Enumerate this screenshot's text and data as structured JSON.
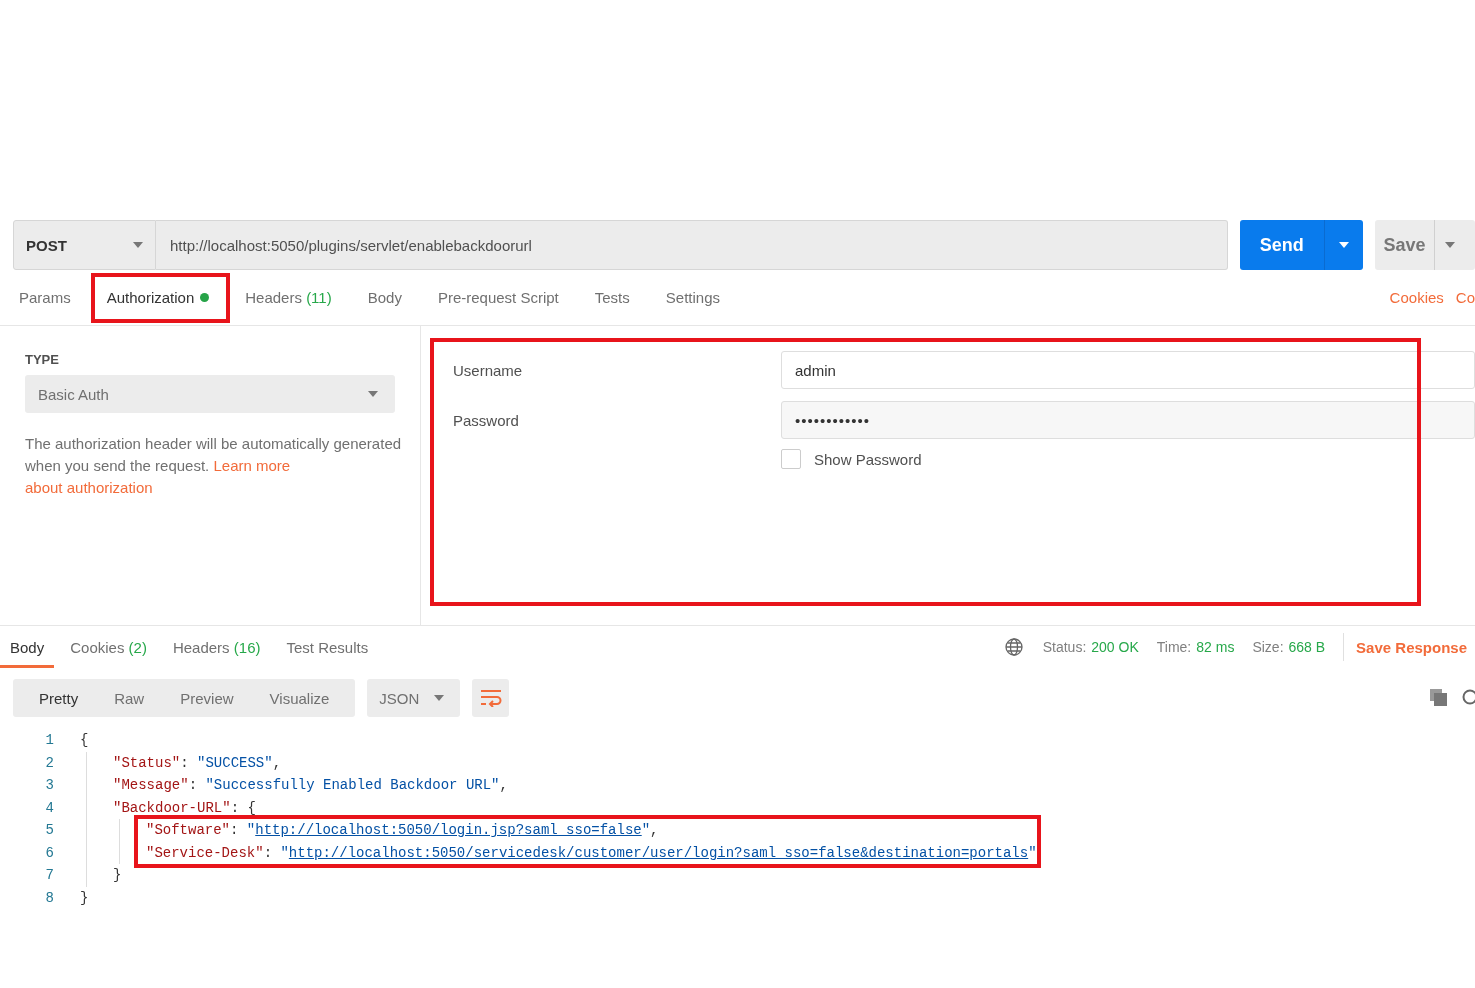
{
  "request": {
    "method": "POST",
    "url": "http://localhost:5050/plugins/servlet/enablebackdoorurl",
    "send_label": "Send",
    "save_label": "Save"
  },
  "request_tabs": [
    {
      "label": "Params",
      "selected": false,
      "indicator": false,
      "highlighted": false
    },
    {
      "label": "Authorization",
      "selected": true,
      "indicator": true,
      "highlighted": true
    },
    {
      "label": "Headers",
      "count": "(11)",
      "selected": false,
      "indicator": false,
      "highlighted": false
    },
    {
      "label": "Body",
      "selected": false,
      "indicator": false,
      "highlighted": false
    },
    {
      "label": "Pre-request Script",
      "selected": false,
      "indicator": false,
      "highlighted": false
    },
    {
      "label": "Tests",
      "selected": false,
      "indicator": false,
      "highlighted": false
    },
    {
      "label": "Settings",
      "selected": false,
      "indicator": false,
      "highlighted": false
    }
  ],
  "request_links": [
    "Cookies",
    "Co"
  ],
  "auth": {
    "type_heading": "TYPE",
    "type_value": "Basic Auth",
    "description": "The authorization header will be automatically generated when you send the request.",
    "learn_more": [
      "Learn more",
      "about authorization"
    ],
    "fields": [
      {
        "label": "Username",
        "value": "admin",
        "kind": "text"
      },
      {
        "label": "Password",
        "value": "••••••••••••",
        "kind": "password"
      }
    ],
    "show_password": {
      "label": "Show Password",
      "checked": false
    },
    "highlighted": true
  },
  "response_tabs": [
    {
      "label": "Body",
      "selected": true
    },
    {
      "label": "Cookies",
      "count": "(2)",
      "selected": false
    },
    {
      "label": "Headers",
      "count": "(16)",
      "selected": false
    },
    {
      "label": "Test Results",
      "selected": false
    }
  ],
  "response_meta": [
    {
      "label": "Status:",
      "value": "200 OK"
    },
    {
      "label": "Time:",
      "value": "82 ms"
    },
    {
      "label": "Size:",
      "value": "668 B"
    }
  ],
  "save_response": "Save Response",
  "format_tabs": [
    {
      "label": "Pretty",
      "selected": true
    },
    {
      "label": "Raw",
      "selected": false
    },
    {
      "label": "Preview",
      "selected": false
    },
    {
      "label": "Visualize",
      "selected": false
    }
  ],
  "language": "JSON",
  "code": {
    "lines": [
      {
        "number": "1",
        "tokens": [
          {
            "kind": "punct",
            "text": "{"
          }
        ]
      },
      {
        "number": "2",
        "tokens": [
          {
            "kind": "key",
            "text": "\"Status\""
          },
          {
            "kind": "punct",
            "text": ": "
          },
          {
            "kind": "string",
            "text": "\"SUCCESS\""
          },
          {
            "kind": "punct",
            "text": ","
          }
        ]
      },
      {
        "number": "3",
        "tokens": [
          {
            "kind": "key",
            "text": "\"Message\""
          },
          {
            "kind": "punct",
            "text": ": "
          },
          {
            "kind": "string",
            "text": "\"Successfully Enabled Backdoor URL\""
          },
          {
            "kind": "punct",
            "text": ","
          }
        ]
      },
      {
        "number": "4",
        "tokens": [
          {
            "kind": "key",
            "text": "\"Backdoor-URL\""
          },
          {
            "kind": "punct",
            "text": ": {"
          }
        ]
      },
      {
        "number": "5",
        "highlighted": true,
        "tokens": [
          {
            "kind": "key",
            "text": "\"Software\""
          },
          {
            "kind": "punct",
            "text": ": "
          },
          {
            "kind": "quote",
            "text": "\""
          },
          {
            "kind": "link",
            "text": "http://localhost:5050/login.jsp?saml_sso=false"
          },
          {
            "kind": "quote",
            "text": "\""
          },
          {
            "kind": "punct",
            "text": ","
          }
        ]
      },
      {
        "number": "6",
        "highlighted": true,
        "tokens": [
          {
            "kind": "key",
            "text": "\"Service-Desk\""
          },
          {
            "kind": "punct",
            "text": ": "
          },
          {
            "kind": "quote",
            "text": "\""
          },
          {
            "kind": "link",
            "text": "http://localhost:5050/servicedesk/customer/user/login?saml_sso=false&destination=portals"
          },
          {
            "kind": "quote",
            "text": "\""
          }
        ]
      },
      {
        "number": "7",
        "tokens": [
          {
            "kind": "punct",
            "text": "}"
          }
        ]
      },
      {
        "number": "8",
        "tokens": [
          {
            "kind": "punct",
            "text": "}"
          }
        ]
      }
    ]
  }
}
